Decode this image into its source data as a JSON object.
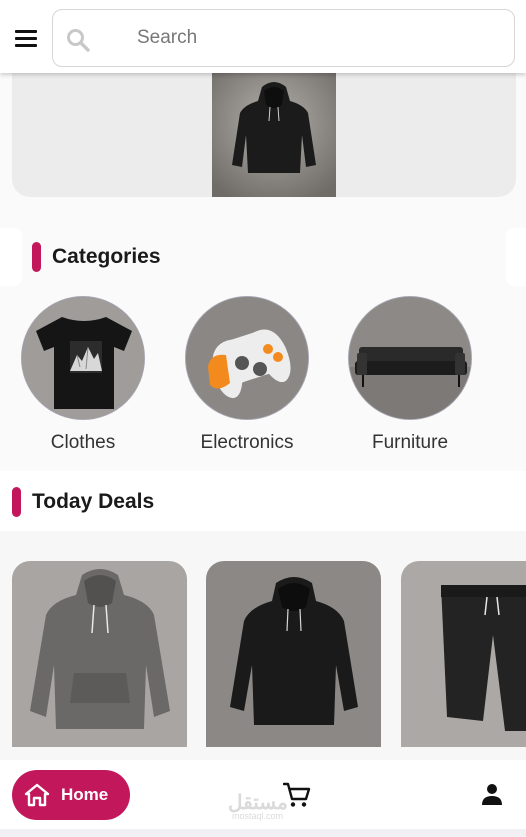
{
  "header": {
    "menu_icon": "hamburger-menu-icon",
    "search_icon": "search-icon",
    "search_placeholder": "Search"
  },
  "banner": {
    "image": "black-hoodie-photo"
  },
  "categories": {
    "title": "Categories",
    "items": [
      {
        "label": "Clothes",
        "image": "black-tshirt-photo"
      },
      {
        "label": "Electronics",
        "image": "game-controller-photo"
      },
      {
        "label": "Furniture",
        "image": "sofa-photo"
      }
    ]
  },
  "deals": {
    "title": "Today Deals",
    "items": [
      {
        "image": "grey-hoodie-photo"
      },
      {
        "image": "black-hoodie-photo"
      },
      {
        "image": "black-sweatpants-photo"
      }
    ]
  },
  "bottom_nav": {
    "home_label": "Home",
    "home_icon": "home-icon",
    "cart_icon": "cart-icon",
    "profile_icon": "profile-icon"
  },
  "watermark": {
    "main": "مستقل",
    "sub": "mostaql.com"
  },
  "colors": {
    "accent": "#c2185b",
    "background": "#f5f5f5",
    "card": "#ffffff"
  }
}
